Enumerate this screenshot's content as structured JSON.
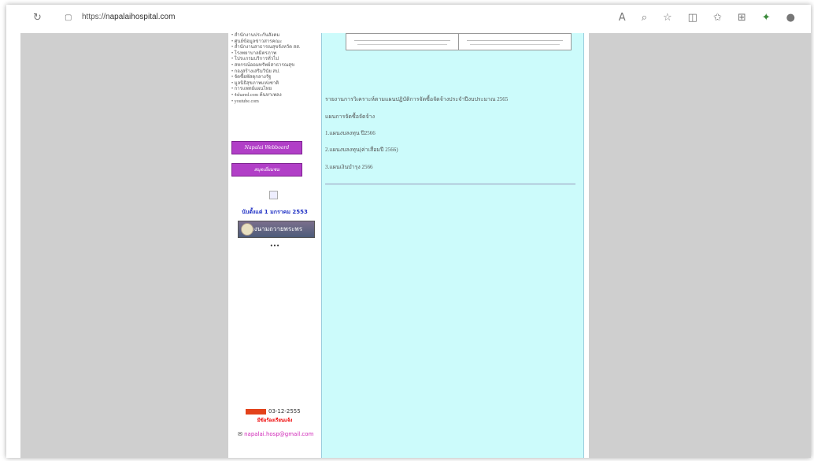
{
  "browser": {
    "url_prefix": "https://",
    "url_domain": "napalaihospital.com",
    "icons": [
      "refresh-icon",
      "site-info-icon",
      "read-aloud-icon",
      "zoom-icon",
      "favorite-icon",
      "split-screen-icon",
      "favorites-bar-icon",
      "collections-icon",
      "extension-icon",
      "profile-icon"
    ]
  },
  "sidebar": {
    "links": [
      "สำนักงานประกันสังคม",
      "ศูนย์ข้อมูลข่าวสารคณะ",
      "สำนักงานสาธารณสุขจังหวัด สส.",
      "โรงพยาบาลมิตรภาพ",
      "โปรแกรมบริการทั่วไป",
      "สหกรณ์ออมทรัพย์สาธารณสุข",
      "กองสร้างเสริมวินัย สป.",
      "จัดซื้อพัสดุกลางรัฐ",
      "มูลนิธิสุขภาพแห่งชาติ",
      "การแพทย์แผนไทย",
      "4shared.com ค้นหาเพลง",
      "youtube.com"
    ],
    "badge1_label": "Napalai Webboard",
    "badge2_label": "สมุดเยี่ยมชม",
    "since_text": "นับตั้งแต่ 1 มกราคม 2553",
    "banner_label": "ลงนามถวายพระพร",
    "dots_text": "•••",
    "updated_date": "03-12-2555",
    "wishes_text": "มีข้อร้องเรียนแจ้ง",
    "email": "napalai.hosp@gmail.com"
  },
  "main": {
    "report_title": "รายงานการวิเคราะห์ตามแผนปฏิบัติการจัดซื้อจัดจ้างประจำปีงบประมาณ 2565",
    "plan_heading": "แผนการจัดซื้อจัดจ้าง",
    "plan_items": [
      "1.แผนงบลงทุน ปี2566",
      "2.แผนงบลงทุน(ค่าเสื่อมปี 2566)",
      "3.แผนเงินบำรุง 2566"
    ]
  },
  "colors": {
    "main_bg": "#ccfbfb",
    "side_gray": "#cfcfcf",
    "badge": "#b13fc7"
  }
}
